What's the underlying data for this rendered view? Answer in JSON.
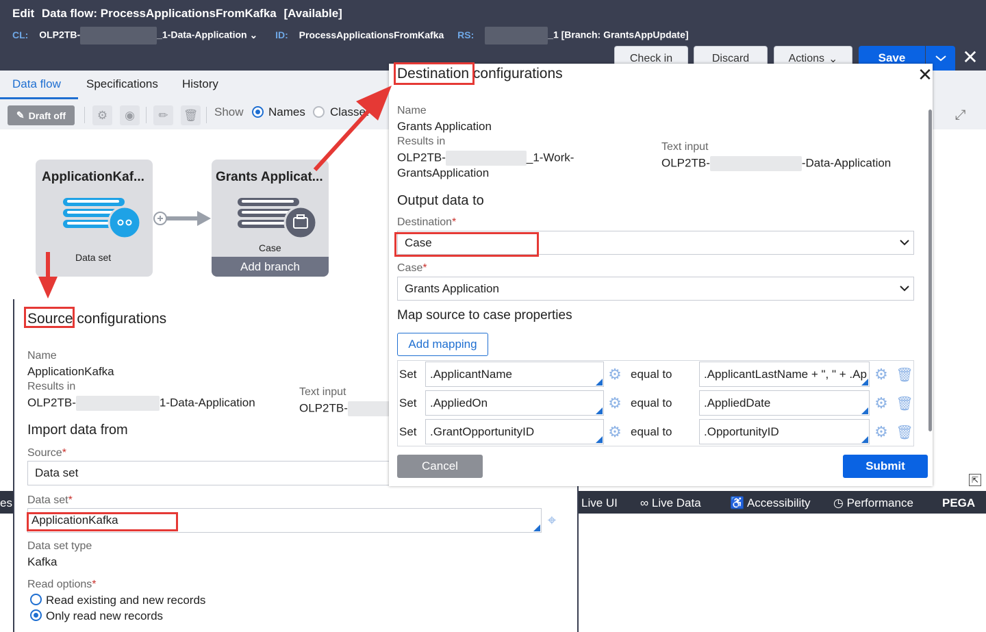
{
  "header": {
    "edit_label": "Edit",
    "title": "Data flow: ProcessApplicationsFromKafka",
    "status": "[Available]",
    "cl_label": "CL:",
    "cl_prefix": "OLP2TB-",
    "cl_suffix": "_1-Data-Application",
    "id_label": "ID:",
    "id_value": "ProcessApplicationsFromKafka",
    "rs_label": "RS:",
    "rs_suffix": "_1 [Branch: GrantsAppUpdate]",
    "buttons": {
      "check_in": "Check in",
      "discard": "Discard",
      "actions": "Actions",
      "save": "Save"
    }
  },
  "tabs": [
    "Data flow",
    "Specifications",
    "History"
  ],
  "toolbar": {
    "draft": "Draft off",
    "show": "Show",
    "names": "Names",
    "classes": "Classes"
  },
  "canvas": {
    "source_node": {
      "title": "ApplicationKaf...",
      "subtitle": "Data set"
    },
    "dest_node": {
      "title": "Grants Applicat...",
      "subtitle": "Case",
      "add_branch": "Add branch"
    }
  },
  "devbar": {
    "live_ui": "Live UI",
    "live_data": "Live Data",
    "accessibility": "Accessibility",
    "performance": "Performance",
    "brand": "PEGA",
    "cut_left": "es"
  },
  "source": {
    "heading_highlight": "Source",
    "heading_rest": "configurations",
    "name_label": "Name",
    "name_value": "ApplicationKafka",
    "results_label": "Results in",
    "results_prefix": "OLP2TB-",
    "results_suffix": "1-Data-Application",
    "text_input_label": "Text input",
    "text_input_prefix": "OLP2TB-",
    "import_heading": "Import data from",
    "source_label": "Source",
    "source_value": "Data set",
    "dataset_label": "Data set",
    "dataset_value": "ApplicationKafka",
    "dataset_type_label": "Data set type",
    "dataset_type_value": "Kafka",
    "read_options_label": "Read options",
    "read_option_1": "Read existing and new records",
    "read_option_2": "Only read new records",
    "required_mark": "*"
  },
  "destination": {
    "heading_highlight": "Destination",
    "heading_rest": "configurations",
    "name_label": "Name",
    "name_value": "Grants Application",
    "results_label": "Results in",
    "results_prefix": "OLP2TB-",
    "results_suffix": "_1-Work-",
    "results_line2": "GrantsApplication",
    "text_input_label": "Text input",
    "text_input_prefix": "OLP2TB-",
    "text_input_suffix": "-Data-Application",
    "output_heading": "Output data to",
    "destination_label": "Destination",
    "destination_value": "Case",
    "case_label": "Case",
    "case_value": "Grants Application",
    "map_heading": "Map source to case properties",
    "add_mapping": "Add mapping",
    "set_label": "Set",
    "equal_to_label": "equal to",
    "mappings": [
      {
        "target": ".ApplicantName",
        "source": ".ApplicantLastName + \", \" + .Ap"
      },
      {
        "target": ".AppliedOn",
        "source": ".AppliedDate"
      },
      {
        "target": ".GrantOpportunityID",
        "source": ".OpportunityID"
      }
    ],
    "cancel": "Cancel",
    "submit": "Submit",
    "required_mark": "*"
  },
  "colors": {
    "header_bg": "#3a3f51",
    "accent": "#0a63e3",
    "highlight_red": "#e53935",
    "arrow_red": "#e53935"
  }
}
